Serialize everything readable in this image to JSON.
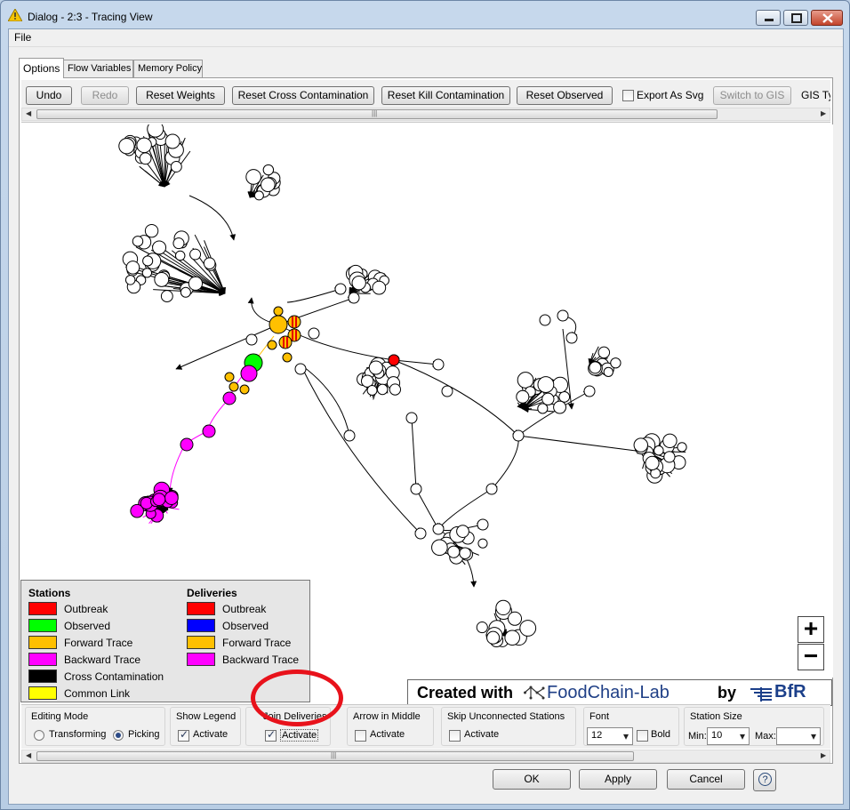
{
  "window": {
    "title": "Dialog - 2:3 - Tracing View",
    "icon": "warning-triangle-icon",
    "controls": [
      "minimize-icon",
      "maximize-icon",
      "close-icon"
    ]
  },
  "menu": {
    "file": "File"
  },
  "tabs": [
    {
      "label": "Options",
      "active": true
    },
    {
      "label": "Flow Variables",
      "active": false
    },
    {
      "label": "Memory Policy",
      "active": false
    }
  ],
  "toolbar": {
    "undo": "Undo",
    "redo": "Redo",
    "reset_weights": "Reset Weights",
    "reset_cross": "Reset Cross Contamination",
    "reset_kill": "Reset Kill Contamination",
    "reset_observed": "Reset Observed",
    "export_svg": "Export As Svg",
    "switch_gis": "Switch to GIS",
    "gis_type": "GIS Typ"
  },
  "legend": {
    "stations_title": "Stations",
    "deliveries_title": "Deliveries",
    "stations": [
      {
        "label": "Outbreak",
        "color": "#ff0000"
      },
      {
        "label": "Observed",
        "color": "#00ff00"
      },
      {
        "label": "Forward Trace",
        "color": "#ffc000"
      },
      {
        "label": "Backward Trace",
        "color": "#ff00ff"
      },
      {
        "label": "Cross Contamination",
        "color": "#000000"
      },
      {
        "label": "Common Link",
        "color": "#ffff00"
      }
    ],
    "deliveries": [
      {
        "label": "Outbreak",
        "color": "#ff0000"
      },
      {
        "label": "Observed",
        "color": "#0000ff"
      },
      {
        "label": "Forward Trace",
        "color": "#ffc000"
      },
      {
        "label": "Backward Trace",
        "color": "#ff00ff"
      }
    ]
  },
  "zoom": {
    "in": "+",
    "out": "−"
  },
  "banner": {
    "created": "Created with",
    "fcl": "FoodChain-Lab",
    "by": "by",
    "bfr": "BfR"
  },
  "options": {
    "editing_mode": {
      "title": "Editing Mode",
      "transforming": "Transforming",
      "picking": "Picking",
      "selected": "Picking"
    },
    "show_legend": {
      "title": "Show Legend",
      "label": "Activate",
      "checked": true
    },
    "join_deliveries": {
      "title": "Join Deliveries",
      "label": "Activate",
      "checked": true
    },
    "arrow_middle": {
      "title": "Arrow in Middle",
      "label": "Activate",
      "checked": false
    },
    "skip_unconnected": {
      "title": "Skip Unconnected Stations",
      "label": "Activate",
      "checked": false
    },
    "font": {
      "title": "Font",
      "size": "12",
      "bold": "Bold"
    },
    "station_size": {
      "title": "Station Size",
      "min_label": "Min:",
      "min_value": "10",
      "max_label": "Max:",
      "max_value": ""
    }
  },
  "buttons": {
    "ok": "OK",
    "apply": "Apply",
    "cancel": "Cancel",
    "help": "?"
  }
}
